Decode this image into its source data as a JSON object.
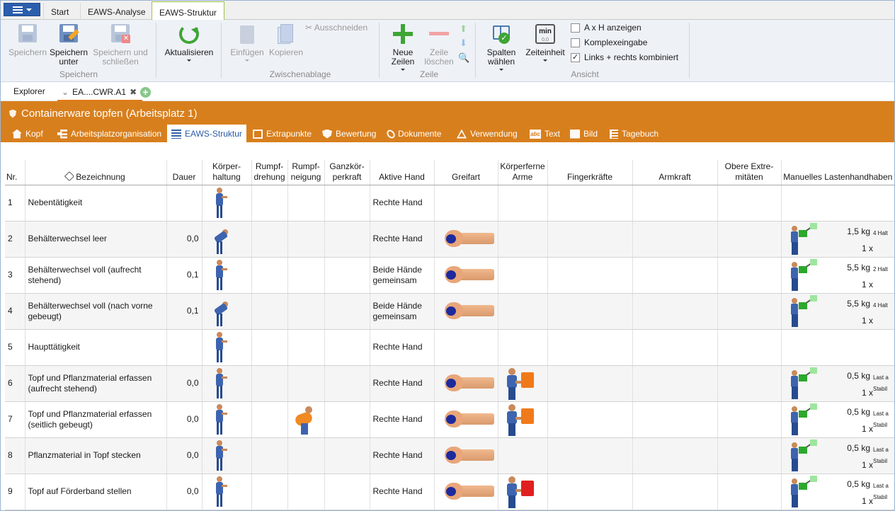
{
  "ribbon_tabs": [
    "Start",
    "EAWS-Analyse",
    "EAWS-Struktur"
  ],
  "ribbon": {
    "speichern": "Speichern",
    "speichern_unter": "Speichern unter",
    "speichern_schliessen": "Speichern und schließen",
    "group_speichern": "Speichern",
    "aktualisieren": "Aktualisieren",
    "einfuegen": "Einfügen",
    "kopieren": "Kopieren",
    "ausschneiden": "Ausschneiden",
    "group_zwischenablage": "Zwischenablage",
    "neue_zeilen": "Neue Zeilen",
    "zeile_loeschen": "Zeile löschen",
    "group_zeile": "Zeile",
    "spalten_waehlen": "Spalten wählen",
    "zeiteinheit": "Zeiteinheit",
    "zeiteinheit_icon_text": "min",
    "zeiteinheit_icon_sub": "0,0",
    "cb_axh": "A x H anzeigen",
    "cb_komplex": "Komplexeingabe",
    "cb_links_rechts": "Links + rechts kombiniert",
    "group_ansicht": "Ansicht"
  },
  "doc_tabs": {
    "explorer": "Explorer",
    "file": "EA....CWR.A1"
  },
  "object_title": "Containerware topfen (Arbeitsplatz 1)",
  "nav_tabs": [
    "Kopf",
    "Arbeitsplatzorganisation",
    "EAWS-Struktur",
    "Extrapunkte",
    "Bewertung",
    "Dokumente",
    "Verwendung",
    "Text",
    "Bild",
    "Tagebuch"
  ],
  "columns": {
    "nr": "Nr.",
    "bezeichnung": "Bezeichnung",
    "dauer": "Dauer",
    "koerperhaltung": "Körper-haltung",
    "rumpfdrehung": "Rumpf-drehung",
    "rumpfneigung": "Rumpf-neigung",
    "ganzkoerperkraft": "Ganzkör-perkraft",
    "aktive_hand": "Aktive Hand",
    "greifart": "Greifart",
    "koerperferne_arme": "Körperferne Arme",
    "fingerkraefte": "Fingerkräfte",
    "armkraft": "Armkraft",
    "obere_extremitaeten": "Obere Extre-mitäten",
    "manuelles_lastenhandhaben": "Manuelles Lastenhandhaben"
  },
  "rows": [
    {
      "nr": "1",
      "bez": "Nebentätigkeit",
      "dauer": "",
      "posture": "stand",
      "rumpf": "",
      "hand": "Rechte Hand",
      "grip": false,
      "farm": "",
      "load": ""
    },
    {
      "nr": "2",
      "bez": "Behälterwechsel leer",
      "dauer": "0,0",
      "posture": "bent",
      "rumpf": "",
      "hand": "Rechte Hand",
      "grip": true,
      "farm": "",
      "load": {
        "kg": "1,5 kg",
        "type": "4 Halt",
        "count": "1 x"
      }
    },
    {
      "nr": "3",
      "bez": "Behälterwechsel voll (aufrecht stehend)",
      "dauer": "0,1",
      "posture": "stand",
      "rumpf": "",
      "hand": "Beide Hände gemeinsam",
      "grip": true,
      "farm": "",
      "load": {
        "kg": "5,5 kg",
        "type": "2 Halt",
        "count": "1 x"
      }
    },
    {
      "nr": "4",
      "bez": "Behälterwechsel voll (nach vorne gebeugt)",
      "dauer": "0,1",
      "posture": "bent",
      "rumpf": "",
      "hand": "Beide Hände gemeinsam",
      "grip": true,
      "farm": "",
      "load": {
        "kg": "5,5 kg",
        "type": "4 Halt",
        "count": "1 x"
      }
    },
    {
      "nr": "5",
      "bez": "Haupttätigkeit",
      "dauer": "",
      "posture": "stand",
      "rumpf": "",
      "hand": "Rechte Hand",
      "grip": false,
      "farm": "",
      "load": ""
    },
    {
      "nr": "6",
      "bez": "Topf und Pflanzmaterial erfassen (aufrecht stehend)",
      "dauer": "0,0",
      "posture": "stand",
      "rumpf": "",
      "hand": "Rechte Hand",
      "grip": true,
      "farm": "orange",
      "load": {
        "kg": "0,5 kg",
        "type": "Last a",
        "type2": "Stabil",
        "count": "1 x"
      }
    },
    {
      "nr": "7",
      "bez": "Topf und Pflanzmaterial erfassen (seitlich gebeugt)",
      "dauer": "0,0",
      "posture": "stand",
      "rumpf": "orange",
      "hand": "Rechte Hand",
      "grip": true,
      "farm": "orange",
      "load": {
        "kg": "0,5 kg",
        "type": "Last a",
        "type2": "Stabil",
        "count": "1 x"
      }
    },
    {
      "nr": "8",
      "bez": "Pflanzmaterial in Topf stecken",
      "dauer": "0,0",
      "posture": "stand",
      "rumpf": "",
      "hand": "Rechte Hand",
      "grip": true,
      "farm": "",
      "load": {
        "kg": "0,5 kg",
        "type": "Last a",
        "type2": "Stabil",
        "count": "1 x"
      }
    },
    {
      "nr": "9",
      "bez": "Topf auf Förderband stellen",
      "dauer": "0,0",
      "posture": "stand",
      "rumpf": "",
      "hand": "Rechte Hand",
      "grip": true,
      "farm": "red",
      "load": {
        "kg": "0,5 kg",
        "type": "Last a",
        "type2": "Stabil",
        "count": "1 x"
      }
    }
  ]
}
